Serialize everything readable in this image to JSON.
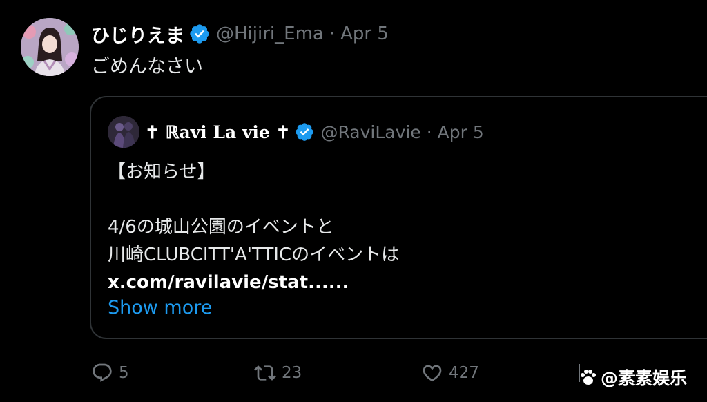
{
  "author": {
    "display_name": "ひじりえま",
    "handle": "@Hijiri_Ema",
    "date": "Apr 5",
    "verified": true
  },
  "tweet": {
    "text": "ごめんなさい"
  },
  "quote": {
    "display_name": "✝ ℝavi La vie ✝",
    "handle": "@RaviLavie",
    "date": "Apr 5",
    "verified": true,
    "lines": [
      "【お知らせ】",
      "",
      "4/6の城山公園のイベントと",
      "川崎CLUBCITT'A'TTICのイベントは",
      "x.com/ravilavie/stat......"
    ],
    "show_more": "Show more"
  },
  "actions": {
    "reply_count": "5",
    "retweet_count": "23",
    "like_count": "427"
  },
  "watermark": {
    "text": "@素素娱乐"
  },
  "colors": {
    "background": "#000000",
    "text": "#e7e9ea",
    "muted": "#71767b",
    "accent": "#1d9bf0",
    "border": "#2f3336"
  },
  "icons": {
    "verified": "verified-badge-icon",
    "reply": "reply-icon",
    "retweet": "retweet-icon",
    "like": "heart-icon",
    "watermark": "paw-icon"
  }
}
